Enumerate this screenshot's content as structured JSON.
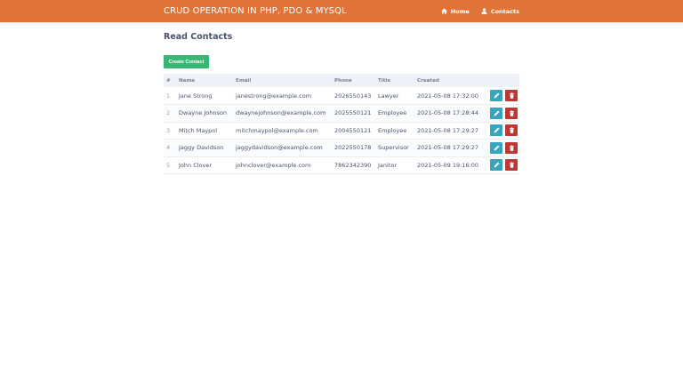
{
  "navbar": {
    "brand": "CRUD OPERATION IN PHP, PDO & MYSQL",
    "links": [
      {
        "label": "Home",
        "icon": "home-icon"
      },
      {
        "label": "Contacts",
        "icon": "user-icon"
      }
    ]
  },
  "page": {
    "title": "Read Contacts",
    "create_button": "Create Contact"
  },
  "table": {
    "headers": [
      "#",
      "Name",
      "Email",
      "Phone",
      "Title",
      "Created"
    ],
    "rows": [
      [
        "1",
        "Jane Strong",
        "janestrong@example.com",
        "2026550143",
        "Lawyer",
        "2021-05-08 17:32:00"
      ],
      [
        "2",
        "Dwayne Johnson",
        "dwaynejohnson@example.com",
        "2025550121",
        "Employee",
        "2021-05-08 17:28:44"
      ],
      [
        "3",
        "Mitch Maypol",
        "mitchmaypol@example.com",
        "2004550121",
        "Employee",
        "2021-05-08 17:29:27"
      ],
      [
        "4",
        "Jaggy Davidson",
        "jaggydavidson@example.com",
        "2022550178",
        "Supervisor",
        "2021-05-08 17:29:27"
      ],
      [
        "5",
        "John Clover",
        "johnclover@example.com",
        "7862342390",
        "Janitor",
        "2021-05-09 19:16:00"
      ]
    ],
    "row_actions": [
      {
        "name": "edit",
        "icon": "pencil-icon",
        "color": "#37a5be"
      },
      {
        "name": "delete",
        "icon": "trash-icon",
        "color": "#be3737"
      }
    ]
  },
  "colors": {
    "navbar": "#e07338",
    "create_button": "#38b673",
    "edit_button": "#37a5be",
    "delete_button": "#be3737"
  }
}
